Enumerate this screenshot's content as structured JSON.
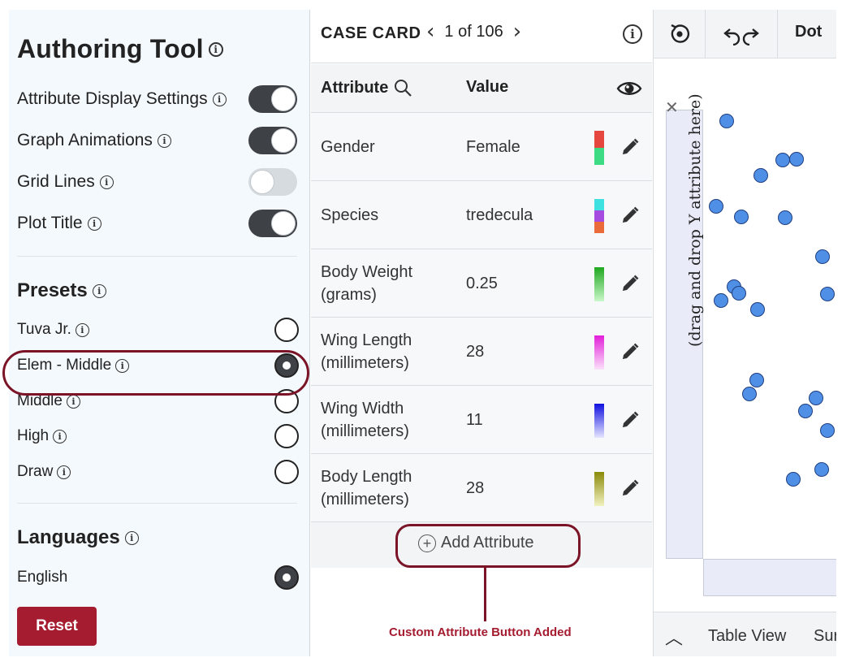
{
  "left_panel": {
    "title": "Authoring Tool",
    "settings": [
      {
        "label": "Attribute Display Settings",
        "on": true
      },
      {
        "label": "Graph Animations",
        "on": true
      },
      {
        "label": "Grid Lines",
        "on": false
      },
      {
        "label": "Plot Title",
        "on": true
      }
    ],
    "presets_heading": "Presets",
    "presets": [
      {
        "label": "Tuva Jr.",
        "selected": false
      },
      {
        "label": "Elem - Middle",
        "selected": true
      },
      {
        "label": "Middle",
        "selected": false
      },
      {
        "label": "High",
        "selected": false
      },
      {
        "label": "Draw",
        "selected": false
      }
    ],
    "languages_heading": "Languages",
    "languages": [
      {
        "label": "English",
        "selected": true
      }
    ],
    "reset_label": "Reset"
  },
  "case_card": {
    "title": "CASE CARD",
    "position": "1 of 106",
    "col_attribute": "Attribute",
    "col_value": "Value",
    "rows": [
      {
        "attribute": "Gender",
        "value": "Female",
        "colors": [
          "#e5463e",
          "#3ddc84"
        ]
      },
      {
        "attribute": "Species",
        "value": "tredecula",
        "colors": [
          "#3fe0e0",
          "#a64be0",
          "#ea6a3a"
        ]
      },
      {
        "attribute": "Body Weight (grams)",
        "value": "0.25",
        "colors": [
          "#1fa81f",
          "#c9f7c9"
        ]
      },
      {
        "attribute": "Wing Length (millimeters)",
        "value": "28",
        "colors": [
          "#e21fd8",
          "#fbe1fa"
        ]
      },
      {
        "attribute": "Wing Width (millimeters)",
        "value": "11",
        "colors": [
          "#1010e0",
          "#e5e5ff"
        ]
      },
      {
        "attribute": "Body Length (millimeters)",
        "value": "28",
        "colors": [
          "#8a8a0a",
          "#f2f2c0"
        ]
      }
    ],
    "add_attribute_label": "Add Attribute",
    "callout": "Custom Attribute Button Added"
  },
  "graph": {
    "mode_label": "Dot",
    "y_drop_hint": "(drag and drop Y attribute here)",
    "table_view_label": "Table View",
    "summary_label_partial": "Sur",
    "dot_color": "#4f8fe6"
  }
}
